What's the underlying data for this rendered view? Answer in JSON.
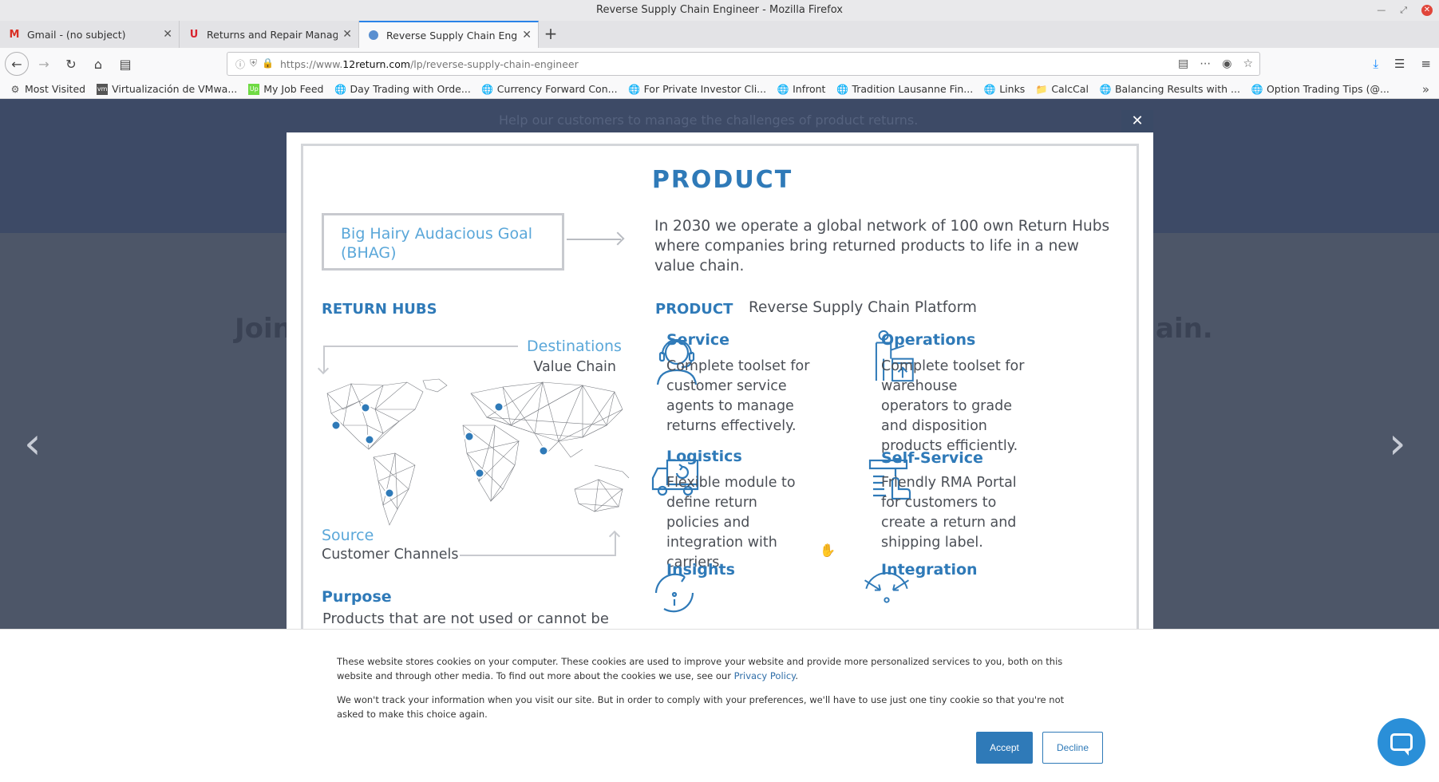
{
  "window": {
    "title": "Reverse Supply Chain Engineer - Mozilla Firefox"
  },
  "tabs": [
    {
      "icon": "gmail-icon",
      "title": "Gmail - (no subject)"
    },
    {
      "icon": "u-brand-icon",
      "title": "Returns and Repair Manage"
    },
    {
      "icon": "globe-icon",
      "title": "Reverse Supply Chain Engin"
    }
  ],
  "url": {
    "prefix": "https://www.",
    "domain": "12return.com",
    "path": "/lp/reverse-supply-chain-engineer"
  },
  "bookmarks": [
    {
      "icon": "gear-icon",
      "label": "Most Visited"
    },
    {
      "icon": "vm-icon",
      "label": "Virtualización de VMwa..."
    },
    {
      "icon": "upwork-icon",
      "label": "My Job Feed"
    },
    {
      "icon": "globe-icon",
      "label": "Day Trading with Orde..."
    },
    {
      "icon": "globe-icon",
      "label": "Currency Forward Con..."
    },
    {
      "icon": "globe-icon",
      "label": "For Private Investor Cli..."
    },
    {
      "icon": "globe-icon",
      "label": "Infront"
    },
    {
      "icon": "globe-icon",
      "label": "Tradition Lausanne Fin..."
    },
    {
      "icon": "globe-icon",
      "label": "Links"
    },
    {
      "icon": "folder-icon",
      "label": "CalcCal"
    },
    {
      "icon": "globe-icon",
      "label": "Balancing Results with ..."
    },
    {
      "icon": "globe-icon",
      "label": "Option Trading Tips (@..."
    }
  ],
  "background": {
    "subtitle": "Help our customers to manage the challenges of product returns.",
    "heading_left": "Join",
    "heading_right": "ain."
  },
  "modal": {
    "title": "PRODUCT",
    "bhag_label": "Big Hairy Audacious Goal (BHAG)",
    "bhag_text": "In 2030 we operate a global network of 100 own Return Hubs where companies bring returned products to life in a new value chain.",
    "return_hubs": "RETURN HUBS",
    "destinations": "Destinations",
    "value_chain": "Value Chain",
    "source": "Source",
    "customer_channels": "Customer Channels",
    "purpose_title": "Purpose",
    "purpose_text": "Products that are not used or cannot be used",
    "product_label": "PRODUCT",
    "product_name": "Reverse Supply Chain Platform",
    "features": [
      {
        "icon": "headset-agent-icon",
        "title": "Service",
        "desc": "Complete toolset for customer service agents to manage returns effectively."
      },
      {
        "icon": "warehouse-operator-icon",
        "title": "Operations",
        "desc": "Complete toolset for warehouse operators to grade and disposition products efficiently."
      },
      {
        "icon": "delivery-truck-icon",
        "title": "Logistics",
        "desc": "Flexible module to define return policies and integration with carriers."
      },
      {
        "icon": "touch-portal-icon",
        "title": "Self-Service",
        "desc": "Friendly RMA Portal for customers to create a return and shipping label."
      },
      {
        "icon": "refresh-insights-icon",
        "title": "Insights",
        "desc": ""
      },
      {
        "icon": "integration-arrows-icon",
        "title": "Integration",
        "desc": ""
      }
    ]
  },
  "cookie": {
    "text1": "These website stores cookies on your computer. These cookies are used to improve your website and provide more personalized services to you, both on this website and through other media. To find out more about the cookies we use, see our ",
    "privacy_link": "Privacy Policy",
    "text1_end": ".",
    "text2": "We won't track your information when you visit our site. But in order to comply with your preferences, we'll have to use just one tiny cookie so that you're not asked to make this choice again.",
    "accept": "Accept",
    "decline": "Decline"
  },
  "colors": {
    "accent": "#2f7ab8",
    "light_accent": "#5aa7d9",
    "firefox_blue": "#2a83e8"
  }
}
